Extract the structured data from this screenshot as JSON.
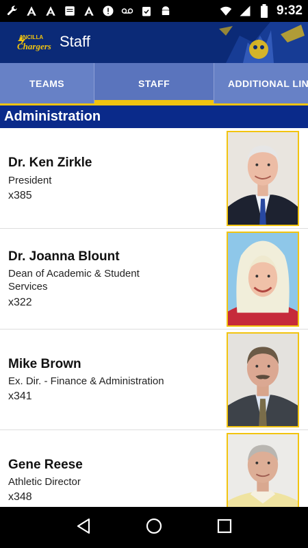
{
  "status_bar": {
    "time": "9:32",
    "left_icons": [
      "wrench-icon",
      "a-icon",
      "a-icon",
      "bible-icon",
      "a-icon",
      "alert-icon",
      "voicemail-icon",
      "clipboard-check-icon",
      "android-icon"
    ],
    "right_icons": [
      "wifi-icon",
      "signal-icon",
      "battery-icon"
    ]
  },
  "app_bar": {
    "logo_text": "ANCILLA Chargers",
    "title": "Staff"
  },
  "tabs": [
    {
      "label": "TEAMS",
      "active": false
    },
    {
      "label": "STAFF",
      "active": true
    },
    {
      "label": "ADDITIONAL LINKS",
      "active": false
    }
  ],
  "section": {
    "title": "Administration"
  },
  "staff": [
    {
      "name": "Dr. Ken Zirkle",
      "role": "President",
      "ext": "x385",
      "photo": "portrait-man-white-hair"
    },
    {
      "name": "Dr. Joanna Blount",
      "role": "Dean of Academic & Student Services",
      "ext": "x322",
      "photo": "portrait-woman-blonde"
    },
    {
      "name": "Mike Brown",
      "role": "Ex. Dir. - Finance & Administration",
      "ext": "x341",
      "photo": "portrait-man-mustache"
    },
    {
      "name": "Gene Reese",
      "role": "Athletic Director",
      "ext": "x348",
      "photo": "portrait-man-gray-hair"
    }
  ],
  "colors": {
    "navy": "#0b2a77",
    "tab_blue": "#6781c6",
    "gold": "#f2c40f",
    "section_blue": "#0a2a8a"
  }
}
